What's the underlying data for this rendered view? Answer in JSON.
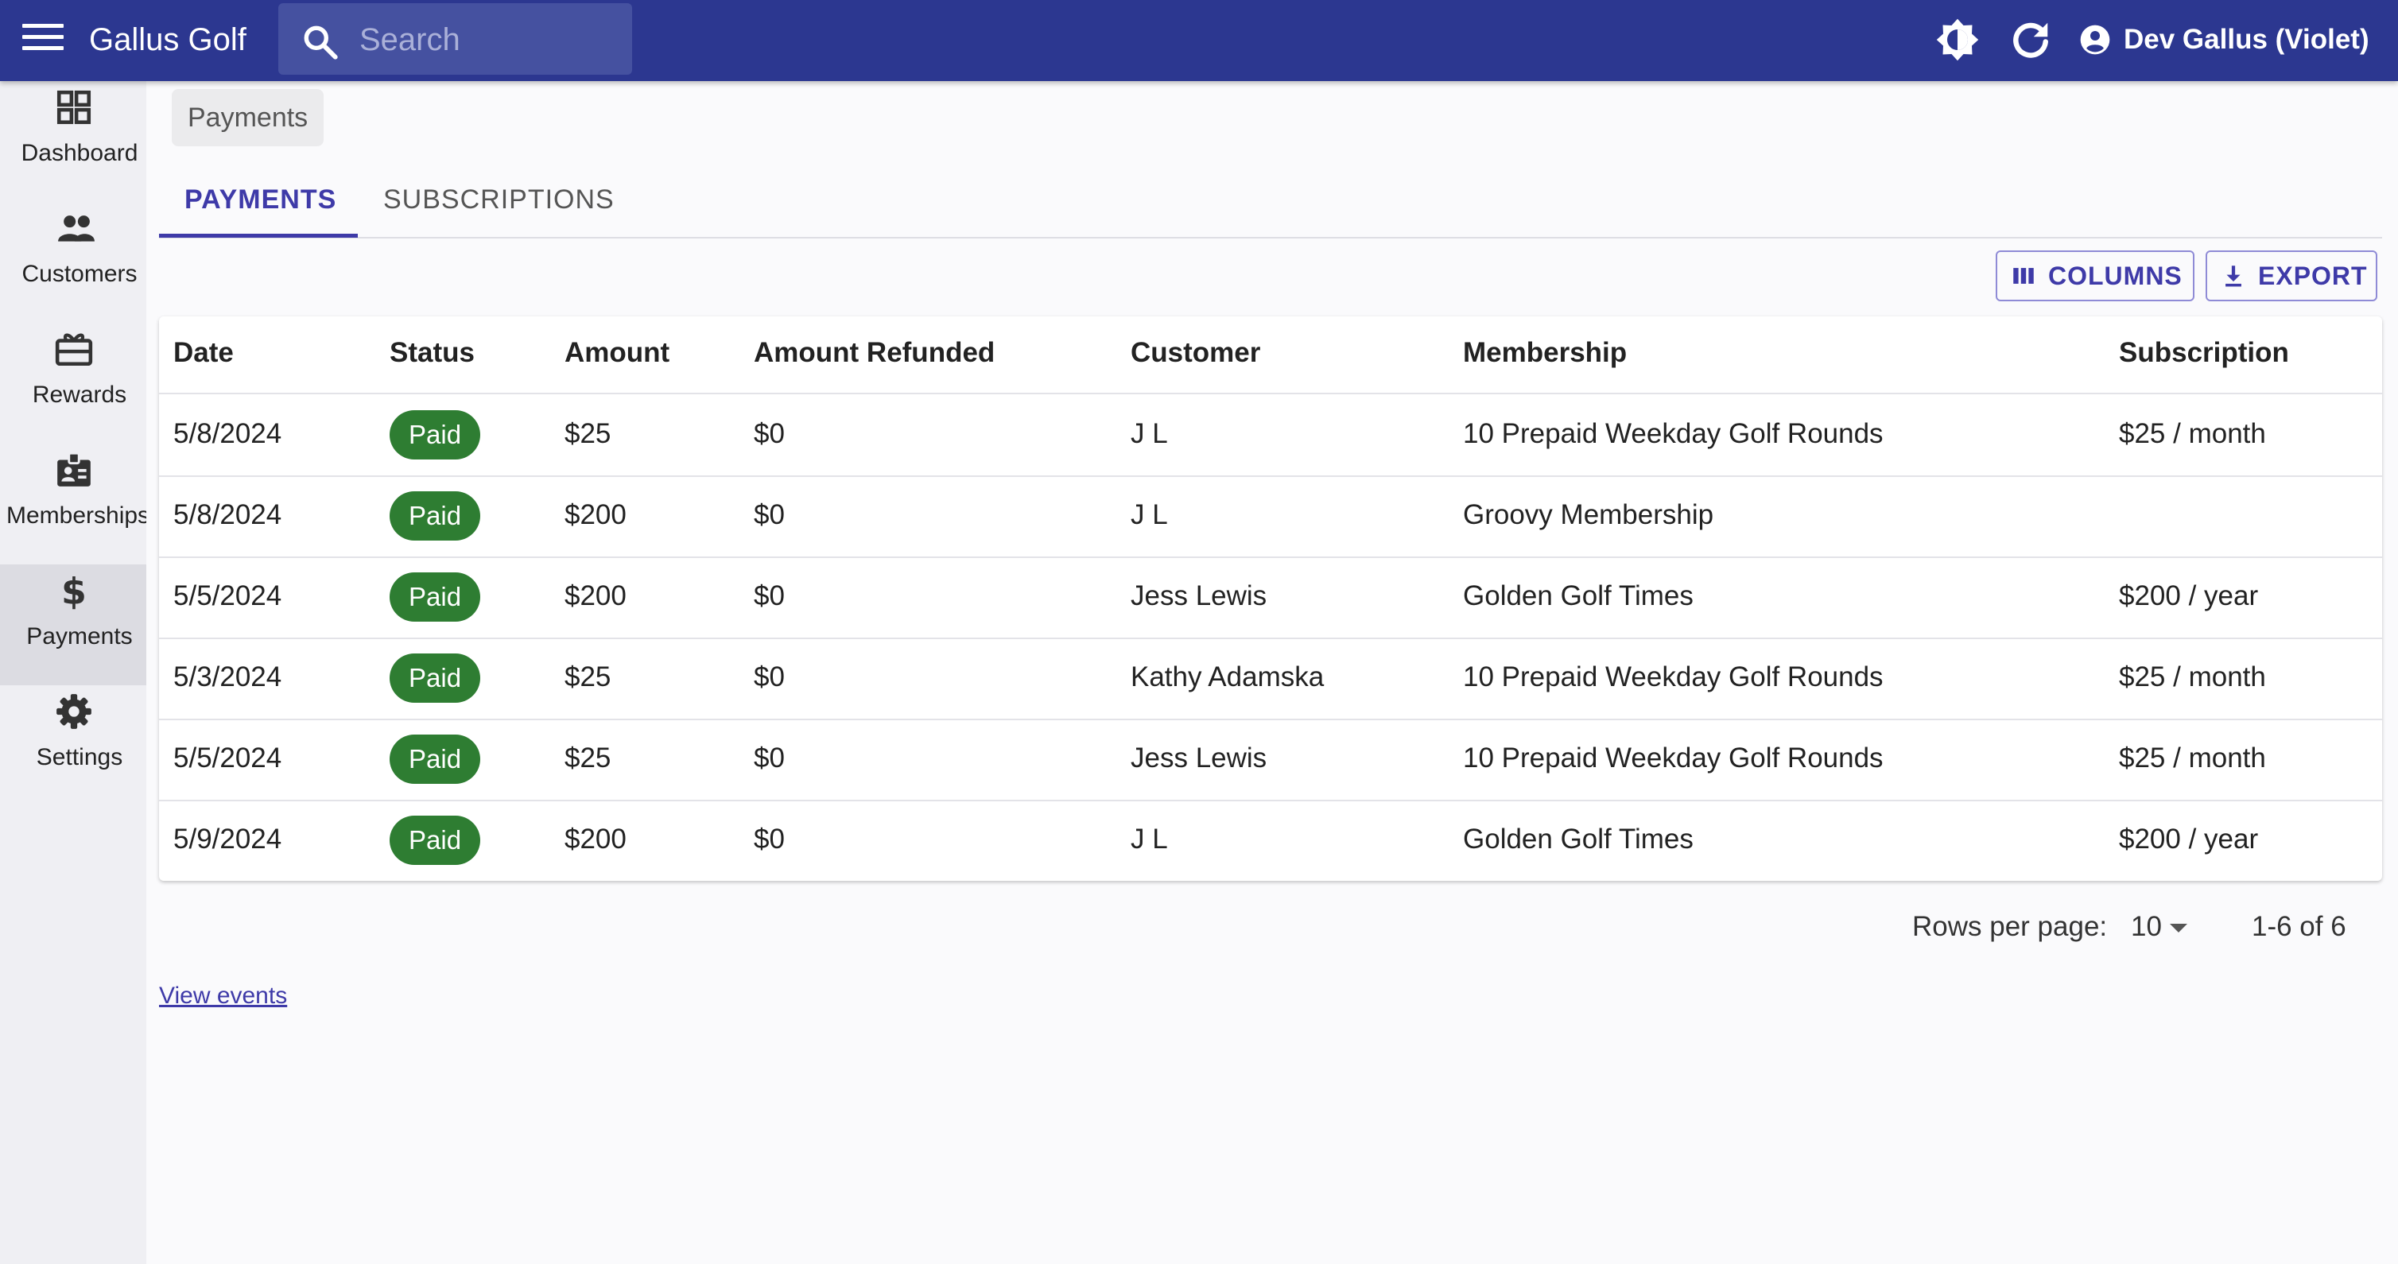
{
  "app": {
    "title": "Gallus Golf"
  },
  "search": {
    "placeholder": "Search"
  },
  "user": {
    "name": "Dev Gallus (Violet)"
  },
  "sidebar": {
    "items": [
      {
        "label": "Dashboard",
        "icon": "dashboard-icon"
      },
      {
        "label": "Customers",
        "icon": "people-icon"
      },
      {
        "label": "Rewards",
        "icon": "gift-icon"
      },
      {
        "label": "Memberships",
        "icon": "badge-icon"
      },
      {
        "label": "Payments",
        "icon": "dollar-icon",
        "active": true
      },
      {
        "label": "Settings",
        "icon": "gear-icon"
      }
    ]
  },
  "breadcrumb": {
    "label": "Payments"
  },
  "tabs": [
    {
      "label": "PAYMENTS",
      "active": true
    },
    {
      "label": "SUBSCRIPTIONS"
    }
  ],
  "toolbar": {
    "columns_label": "COLUMNS",
    "export_label": "EXPORT"
  },
  "table": {
    "headers": [
      "Date",
      "Status",
      "Amount",
      "Amount Refunded",
      "Customer",
      "Membership",
      "Subscription"
    ],
    "rows": [
      {
        "date": "5/8/2024",
        "status": "Paid",
        "amount": "$25",
        "refunded": "$0",
        "customer": "J L",
        "membership": "10 Prepaid Weekday Golf Rounds",
        "subscription": "$25 / month"
      },
      {
        "date": "5/8/2024",
        "status": "Paid",
        "amount": "$200",
        "refunded": "$0",
        "customer": "J L",
        "membership": "Groovy Membership",
        "subscription": ""
      },
      {
        "date": "5/5/2024",
        "status": "Paid",
        "amount": "$200",
        "refunded": "$0",
        "customer": "Jess Lewis",
        "membership": "Golden Golf Times",
        "subscription": "$200 / year"
      },
      {
        "date": "5/3/2024",
        "status": "Paid",
        "amount": "$25",
        "refunded": "$0",
        "customer": "Kathy Adamska",
        "membership": "10 Prepaid Weekday Golf Rounds",
        "subscription": "$25 / month"
      },
      {
        "date": "5/5/2024",
        "status": "Paid",
        "amount": "$25",
        "refunded": "$0",
        "customer": "Jess Lewis",
        "membership": "10 Prepaid Weekday Golf Rounds",
        "subscription": "$25 / month"
      },
      {
        "date": "5/9/2024",
        "status": "Paid",
        "amount": "$200",
        "refunded": "$0",
        "customer": "J L",
        "membership": "Golden Golf Times",
        "subscription": "$200 / year"
      }
    ]
  },
  "pagination": {
    "rows_per_page_label": "Rows per page:",
    "rows_per_page": "10",
    "range": "1-6 of 6"
  },
  "footer": {
    "view_events": "View events"
  },
  "colors": {
    "appbar": "#2c3790",
    "accent": "#3e3aa8",
    "paid_chip": "#2e7d32"
  }
}
